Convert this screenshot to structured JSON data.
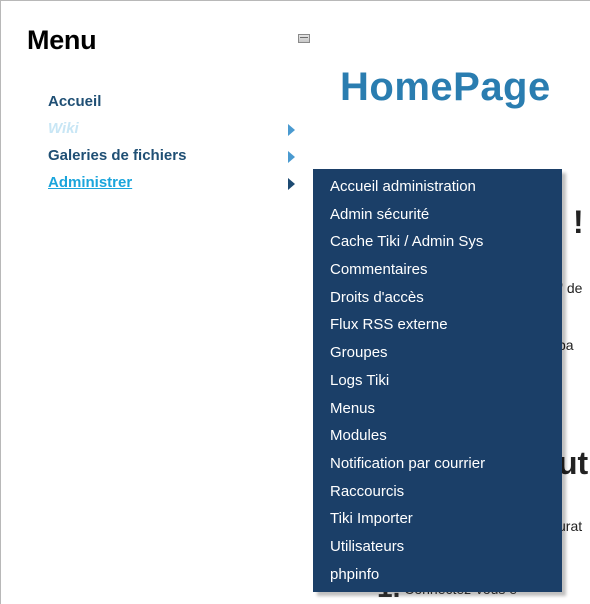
{
  "sidebar": {
    "title": "Menu",
    "items": [
      {
        "label": "Accueil",
        "has_submenu": false
      },
      {
        "label": "Wiki",
        "has_submenu": true
      },
      {
        "label": "Galeries de fichiers",
        "has_submenu": true
      },
      {
        "label": "Administrer",
        "has_submenu": true
      }
    ]
  },
  "submenu": {
    "parent": "Administrer",
    "items": [
      "Accueil administration",
      "Admin sécurité",
      "Cache Tiki / Admin Sys",
      "Commentaires",
      "Droits d'accès",
      "Flux RSS externe",
      "Groupes",
      "Logs Tiki",
      "Menus",
      "Modules",
      "Notification par courrier",
      "Raccourcis",
      "Tiki Importer",
      "Utilisateurs",
      "phpinfo"
    ]
  },
  "main": {
    "page_title": "HomePage",
    "fragments": {
      "excl": "!",
      "de": "\" de",
      "pa": "pa",
      "ut": "ut",
      "ura": "urat",
      "step_number": "1.",
      "step_text": "Connectez-vous e"
    }
  },
  "colors": {
    "submenu_bg": "#1b3f68",
    "page_title": "#2a7db0",
    "link": "#1f4f74",
    "active_link": "#1aa5dc"
  }
}
